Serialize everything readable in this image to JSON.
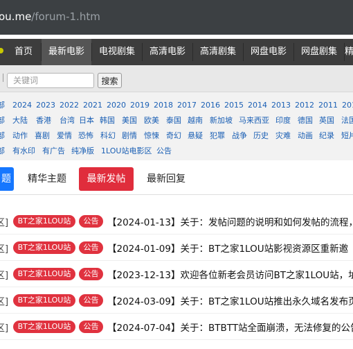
{
  "address_bar": {
    "host": "ou.me",
    "path": "/forum-1.htm"
  },
  "nav": {
    "items": [
      "首页",
      "最新电影",
      "电视剧集",
      "高清电影",
      "高清剧集",
      "网盘电影",
      "网盘剧集",
      "精"
    ],
    "active_index": 1
  },
  "search": {
    "placeholder": "关键词",
    "value": "",
    "button_label": "搜索"
  },
  "filters": {
    "years_label": "部",
    "years": [
      "2024",
      "2023",
      "2022",
      "2021",
      "2020",
      "2019",
      "2018",
      "2017",
      "2016",
      "2015",
      "2014",
      "2013",
      "2012",
      "2011",
      "201"
    ],
    "regions_label": "部",
    "regions": [
      "大陆",
      "香港",
      "台湾",
      "日本",
      "韩国",
      "美国",
      "欧美",
      "泰国",
      "越南",
      "新加坡",
      "马来西亚",
      "印度",
      "德国",
      "英国",
      "法国"
    ],
    "genres_label": "部",
    "genres": [
      "动作",
      "喜剧",
      "爱情",
      "恐怖",
      "科幻",
      "剧情",
      "惊悚",
      "奇幻",
      "悬疑",
      "犯罪",
      "战争",
      "历史",
      "灾难",
      "动画",
      "纪录",
      "短片"
    ],
    "others_label": "部",
    "others": [
      "有水印",
      "有广告",
      "纯净版",
      "1LOU站电影区",
      "公告"
    ]
  },
  "tabs": {
    "first": "题",
    "featured": "精华主题",
    "latest_post": "最新发帖",
    "latest_reply": "最新回复"
  },
  "threads": [
    {
      "prefix": "区]",
      "site_badge": "BT之家1LOU站",
      "type_badge": "公告",
      "title": "【2024-01-13】关于：发帖问题的说明和如何发帖的流程，"
    },
    {
      "prefix": "区]",
      "site_badge": "BT之家1LOU站",
      "type_badge": "公告",
      "title": "【2024-01-09】关于：BT之家1LOU站影视资源区重新邀"
    },
    {
      "prefix": "区]",
      "site_badge": "BT之家1LOU站",
      "type_badge": "公告",
      "title": "【2023-12-13】欢迎各位新老会员访问BT之家1LOU站，址"
    },
    {
      "prefix": "区]",
      "site_badge": "BT之家1LOU站",
      "type_badge": "公告",
      "title": "【2024-03-09】关于：BT之家1LOU站推出永久域名发布页"
    },
    {
      "prefix": "区]",
      "site_badge": "BT之家1LOU站",
      "type_badge": "公告",
      "title": "【2024-07-04】关于：BTBTT站全面崩溃，无法修复的公告"
    }
  ],
  "colors": {
    "badge_red": "#e0323f",
    "tab_blue": "#1677ff",
    "tab_red": "#e02d3c",
    "link_blue": "#1a5fb4",
    "nav_bg": "#3d3d3d"
  }
}
